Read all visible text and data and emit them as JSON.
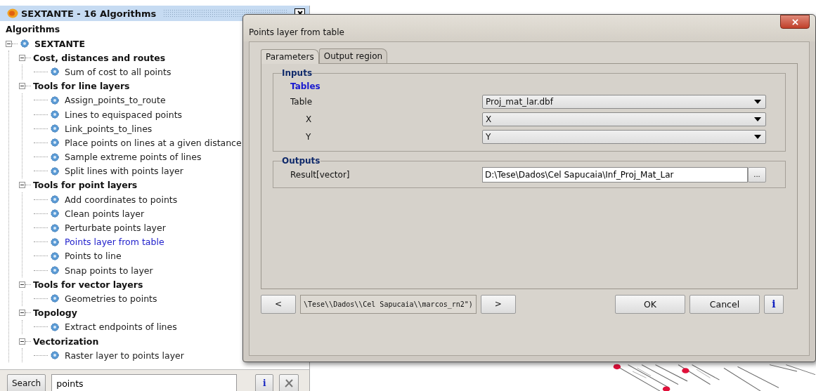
{
  "toolbox": {
    "title": "SEXTANTE - 16 Algorithms",
    "heading": "Algorithms",
    "tree": [
      {
        "label": "SEXTANTE",
        "expanded": true,
        "children": [
          {
            "label": "Cost, distances and routes",
            "expanded": true,
            "children": [
              {
                "label": "Sum of cost to all points",
                "selected": false
              }
            ]
          },
          {
            "label": "Tools for line layers",
            "expanded": true,
            "children": [
              {
                "label": "Assign_points_to_route",
                "selected": false
              },
              {
                "label": "Lines to equispaced points",
                "selected": false
              },
              {
                "label": "Link_points_to_lines",
                "selected": false
              },
              {
                "label": "Place points on lines at a given distance",
                "selected": false
              },
              {
                "label": "Sample extreme points of lines",
                "selected": false
              },
              {
                "label": "Split lines with points layer",
                "selected": false
              }
            ]
          },
          {
            "label": "Tools for point layers",
            "expanded": true,
            "children": [
              {
                "label": "Add coordinates to points",
                "selected": false
              },
              {
                "label": "Clean points layer",
                "selected": false
              },
              {
                "label": "Perturbate points layer",
                "selected": false
              },
              {
                "label": "Points layer from table",
                "selected": true
              },
              {
                "label": "Points to line",
                "selected": false
              },
              {
                "label": "Snap points to layer",
                "selected": false
              }
            ]
          },
          {
            "label": "Tools for vector layers",
            "expanded": true,
            "children": [
              {
                "label": "Geometries to points",
                "selected": false
              }
            ]
          },
          {
            "label": "Topology",
            "expanded": true,
            "children": [
              {
                "label": "Extract endpoints of lines",
                "selected": false
              }
            ]
          },
          {
            "label": "Vectorization",
            "expanded": true,
            "children": [
              {
                "label": "Raster layer to points layer",
                "selected": false
              }
            ]
          }
        ]
      }
    ],
    "search_button": "Search",
    "search": {
      "value": "points"
    },
    "info_button": "i"
  },
  "dialog": {
    "title": "Points layer from table",
    "tabs": [
      {
        "label": "Parameters",
        "selected": true
      },
      {
        "label": "Output region",
        "selected": false
      }
    ],
    "inputs": {
      "legend": "Inputs",
      "section": "Tables",
      "fields": [
        {
          "label": "Table",
          "value": "Proj_mat_lar.dbf",
          "indent": false
        },
        {
          "label": "X",
          "value": "X",
          "indent": true
        },
        {
          "label": "Y",
          "value": "Y",
          "indent": true
        }
      ]
    },
    "outputs": {
      "legend": "Outputs",
      "fields": [
        {
          "label": "Result[vector]",
          "value": "D:\\Tese\\Dados\\Cel Sapucaia\\Inf_Proj_Mat_Lar",
          "browse": "..."
        }
      ]
    },
    "prev_button": "<",
    "command": "\\Tese\\\\Dados\\\\Cel Sapucaia\\\\marcos_rn2\")",
    "next_button": ">",
    "ok_button": "OK",
    "cancel_button": "Cancel",
    "info_button": "i"
  }
}
